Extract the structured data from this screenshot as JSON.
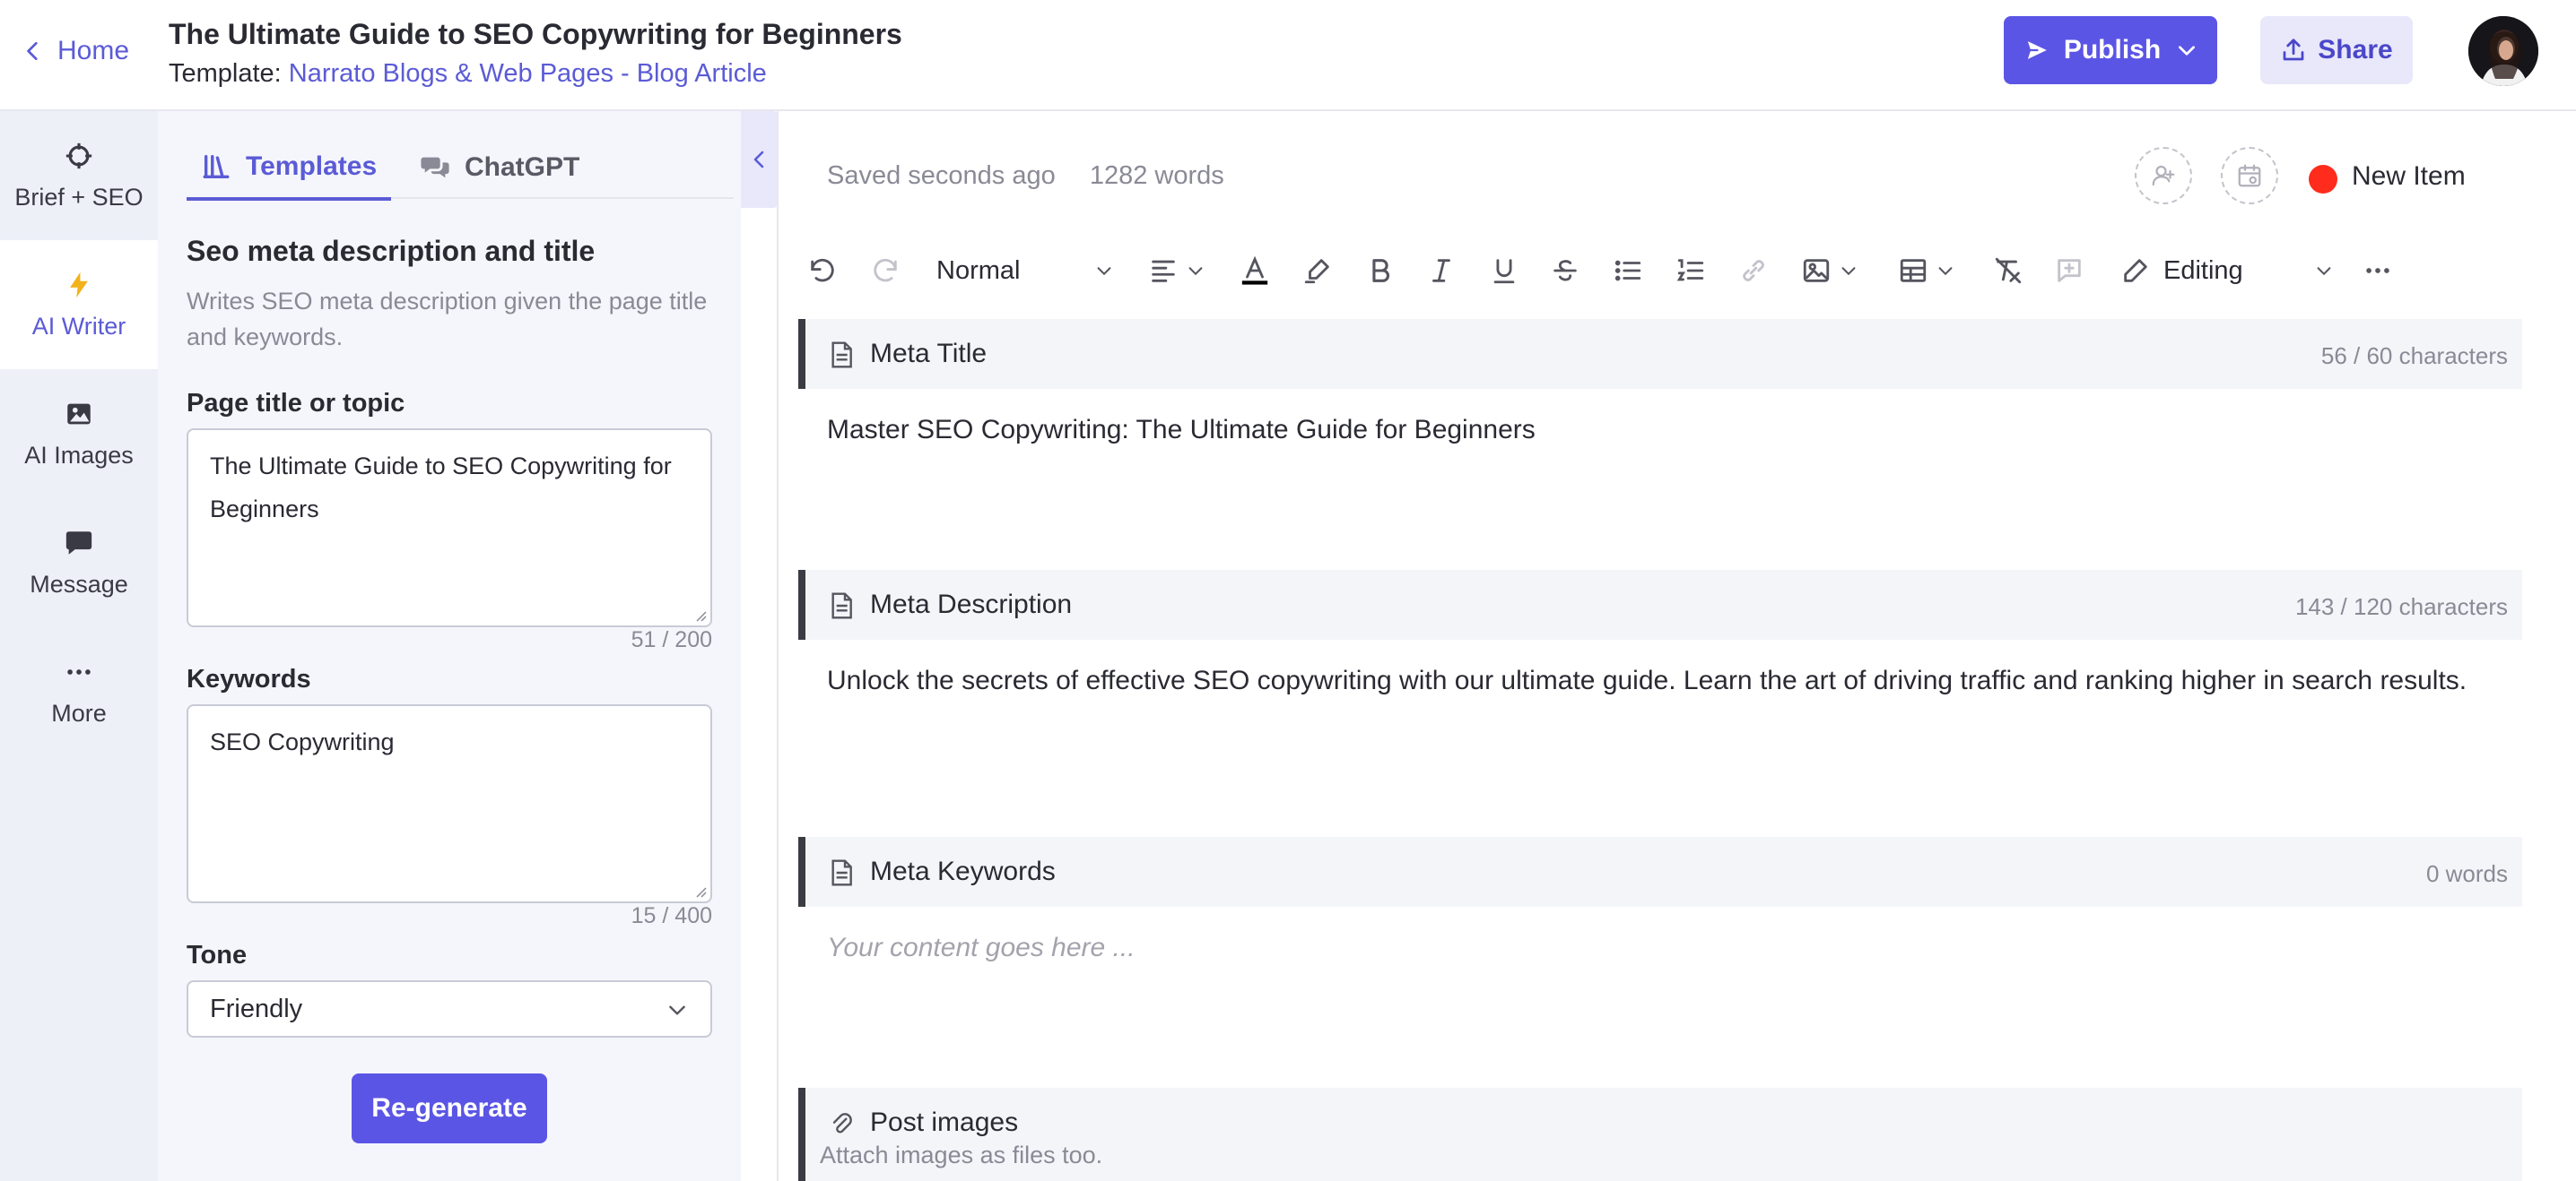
{
  "header": {
    "home_label": "Home",
    "title": "The Ultimate Guide to SEO Copywriting for Beginners",
    "template_prefix": "Template:",
    "template_name": "Narrato Blogs & Web Pages - Blog Article",
    "publish_label": "Publish",
    "share_label": "Share"
  },
  "rail": {
    "items": [
      {
        "label": "Brief + SEO",
        "icon": "crosshair-icon"
      },
      {
        "label": "AI Writer",
        "icon": "lightning-icon",
        "active": true
      },
      {
        "label": "AI Images",
        "icon": "image-icon"
      },
      {
        "label": "Message",
        "icon": "message-icon"
      },
      {
        "label": "More",
        "icon": "more-dots-icon"
      }
    ]
  },
  "panel": {
    "tabs": [
      {
        "label": "Templates",
        "icon": "library-icon",
        "active": true
      },
      {
        "label": "ChatGPT",
        "icon": "chat-bubbles-icon"
      }
    ],
    "title": "Seo meta description and title",
    "description": "Writes SEO meta description given the page title and keywords.",
    "fields": {
      "page_title": {
        "label": "Page title or topic",
        "value": "The Ultimate Guide to SEO Copywriting for Beginners",
        "counter": "51 / 200"
      },
      "keywords": {
        "label": "Keywords",
        "value": "SEO Copywriting",
        "counter": "15 / 400"
      },
      "tone": {
        "label": "Tone",
        "value": "Friendly"
      }
    },
    "regenerate_label": "Re-generate"
  },
  "editor": {
    "saved_status": "Saved seconds ago",
    "word_count": "1282 words",
    "status_label": "New Item",
    "status_color": "#ff2b1c",
    "toolbar": {
      "paragraph_style": "Normal",
      "mode": "Editing"
    },
    "sections": [
      {
        "title": "Meta Title",
        "count": "56 / 60 characters",
        "content": "Master SEO Copywriting: The Ultimate Guide for Beginners"
      },
      {
        "title": "Meta Description",
        "count": "143 / 120 characters",
        "content": "Unlock the secrets of effective SEO copywriting with our ultimate guide. Learn the art of driving traffic and ranking higher in search results."
      },
      {
        "title": "Meta Keywords",
        "count": "0 words",
        "placeholder": "Your content goes here ..."
      },
      {
        "title": "Post images",
        "note": "Attach images as files too."
      }
    ]
  },
  "colors": {
    "accent": "#5b55e6",
    "accent_text": "#5b5bd6",
    "rail_bg": "#eef0f8",
    "panel_bg": "#f5f6fb"
  }
}
